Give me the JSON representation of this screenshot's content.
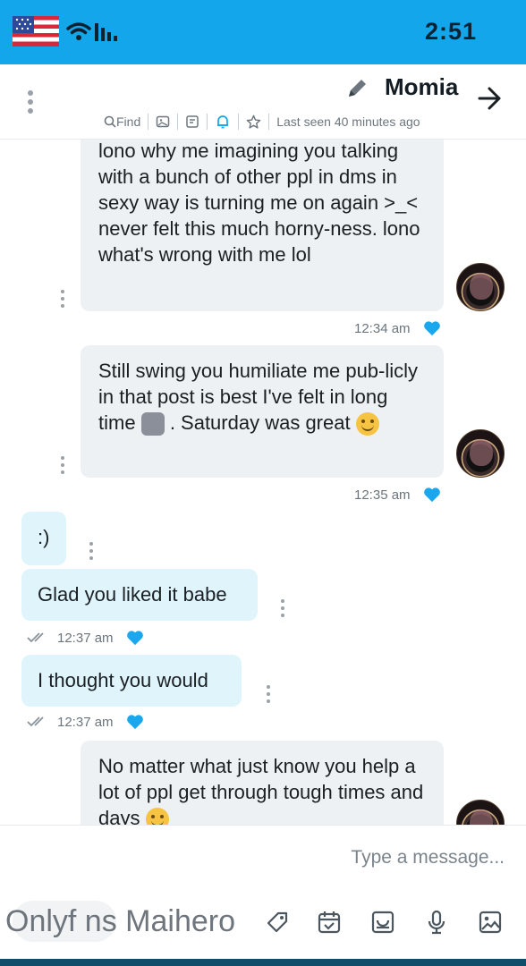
{
  "status_bar": {
    "time": "2:51"
  },
  "header": {
    "contact_name": "Momia",
    "last_seen": "Last seen 40 minutes ago",
    "find_label": "Find"
  },
  "messages": [
    {
      "side": "in",
      "text": "lono why me imagining you talking with a bunch of other ppl in dms in sexy way is turning me on again >_< never felt this much horny-ness. lono what's wrong with me lol",
      "time": "12:34 am"
    },
    {
      "side": "in",
      "text": "Still swing you humiliate me pub-licly in that post is best I've felt in long time",
      "text_after_emoji": ". Saturday was great",
      "time": "12:35 am"
    },
    {
      "side": "out",
      "text": ":)"
    },
    {
      "side": "out",
      "text": "Glad you liked it babe",
      "time": "12:37 am"
    },
    {
      "side": "out",
      "text": "I thought you would",
      "time": "12:37 am"
    },
    {
      "side": "in",
      "text": "No matter what just know you help a lot of ppl get through tough times and days"
    }
  ],
  "composer": {
    "placeholder": "Type a message...",
    "watermark": "Onlyf ns Maihero"
  },
  "icons": [
    "flag-icon",
    "wifi-icon",
    "signal-icon",
    "back-arrow-icon",
    "pencil-icon",
    "more-icon",
    "find-icon",
    "image-icon",
    "note-icon",
    "bell-icon",
    "star-icon",
    "heart-icon",
    "read-checks-icon",
    "tag-icon",
    "calendar-icon",
    "photo-vault-icon",
    "mic-icon",
    "gallery-icon"
  ],
  "colors": {
    "accent": "#13a6ea",
    "incoming_bubble": "#eef1f3",
    "outgoing_bubble": "#dff5fb",
    "heart": "#1aa7ee"
  }
}
